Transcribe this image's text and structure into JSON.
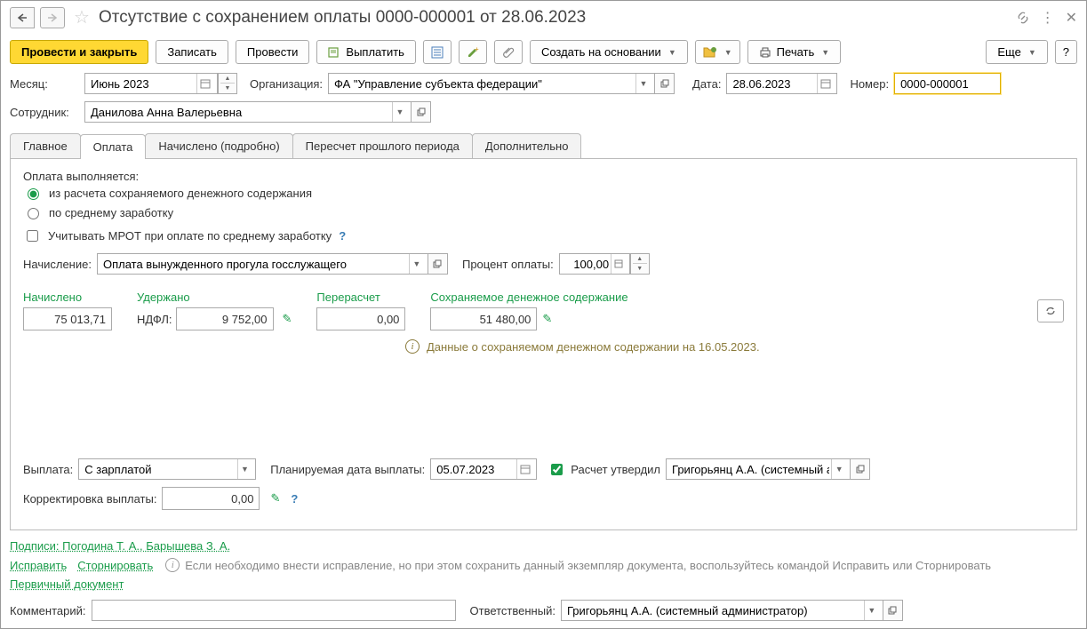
{
  "title": "Отсутствие с сохранением оплаты 0000-000001 от 28.06.2023",
  "toolbar": {
    "post_close": "Провести и закрыть",
    "save": "Записать",
    "post": "Провести",
    "pay": "Выплатить",
    "create_based": "Создать на основании",
    "print": "Печать",
    "more": "Еще"
  },
  "header": {
    "month_label": "Месяц:",
    "month_value": "Июнь 2023",
    "org_label": "Организация:",
    "org_value": "ФА \"Управление субъекта федерации\"",
    "date_label": "Дата:",
    "date_value": "28.06.2023",
    "number_label": "Номер:",
    "number_value": "0000-000001",
    "employee_label": "Сотрудник:",
    "employee_value": "Данилова Анна Валерьевна"
  },
  "tabs": {
    "main": "Главное",
    "payment": "Оплата",
    "accrued": "Начислено (подробно)",
    "recalc": "Пересчет прошлого периода",
    "extra": "Дополнительно"
  },
  "payment_tab": {
    "intro": "Оплата выполняется:",
    "radio1": "из расчета сохраняемого денежного содержания",
    "radio2": "по среднему заработку",
    "check_mrot": "Учитывать МРОТ при оплате по среднему заработку",
    "accrual_label": "Начисление:",
    "accrual_value": "Оплата вынужденного прогула госслужащего",
    "percent_label": "Процент оплаты:",
    "percent_value": "100,00",
    "col_accrued": "Начислено",
    "col_withheld": "Удержано",
    "col_recalc": "Перерасчет",
    "col_preserved": "Сохраняемое денежное содержание",
    "accrued_value": "75 013,71",
    "ndfl_label": "НДФЛ:",
    "ndfl_value": "9 752,00",
    "recalc_value": "0,00",
    "preserved_value": "51 480,00",
    "info_text": "Данные о сохраняемом денежном содержании на 16.05.2023.",
    "payout_label": "Выплата:",
    "payout_value": "С зарплатой",
    "planned_date_label": "Планируемая дата выплаты:",
    "planned_date_value": "05.07.2023",
    "approved_label": "Расчет утвердил",
    "approved_value": "Григорьянц А.А. (системный адми",
    "correction_label": "Корректировка выплаты:",
    "correction_value": "0,00"
  },
  "footer": {
    "signatures": "Подписи: Погодина Т. А., Барышева З. А.",
    "fix": "Исправить",
    "storno": "Сторнировать",
    "fix_hint": "Если необходимо внести исправление, но при этом сохранить данный экземпляр документа, воспользуйтесь командой Исправить или Сторнировать",
    "primary_doc": "Первичный документ",
    "comment_label": "Комментарий:",
    "comment_value": "",
    "responsible_label": "Ответственный:",
    "responsible_value": "Григорьянц А.А. (системный администратор)"
  }
}
